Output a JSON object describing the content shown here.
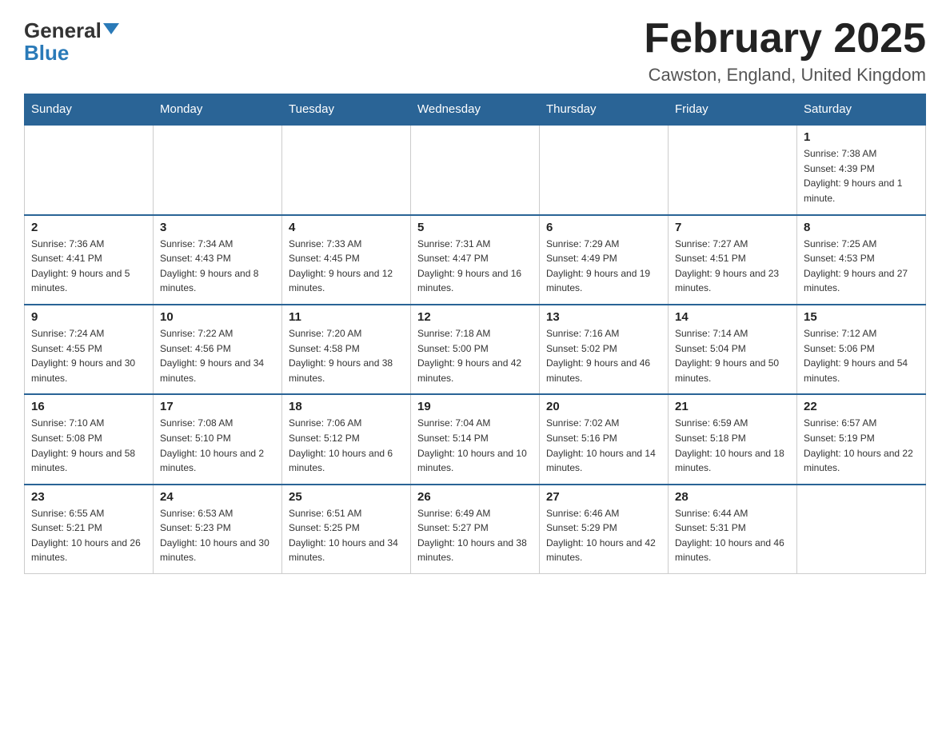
{
  "header": {
    "logo_general": "General",
    "logo_blue": "Blue",
    "title": "February 2025",
    "subtitle": "Cawston, England, United Kingdom"
  },
  "days_of_week": [
    "Sunday",
    "Monday",
    "Tuesday",
    "Wednesday",
    "Thursday",
    "Friday",
    "Saturday"
  ],
  "weeks": [
    [
      {
        "day": "",
        "sunrise": "",
        "sunset": "",
        "daylight": "",
        "empty": true
      },
      {
        "day": "",
        "sunrise": "",
        "sunset": "",
        "daylight": "",
        "empty": true
      },
      {
        "day": "",
        "sunrise": "",
        "sunset": "",
        "daylight": "",
        "empty": true
      },
      {
        "day": "",
        "sunrise": "",
        "sunset": "",
        "daylight": "",
        "empty": true
      },
      {
        "day": "",
        "sunrise": "",
        "sunset": "",
        "daylight": "",
        "empty": true
      },
      {
        "day": "",
        "sunrise": "",
        "sunset": "",
        "daylight": "",
        "empty": true
      },
      {
        "day": "1",
        "sunrise": "Sunrise: 7:38 AM",
        "sunset": "Sunset: 4:39 PM",
        "daylight": "Daylight: 9 hours and 1 minute.",
        "empty": false
      }
    ],
    [
      {
        "day": "2",
        "sunrise": "Sunrise: 7:36 AM",
        "sunset": "Sunset: 4:41 PM",
        "daylight": "Daylight: 9 hours and 5 minutes.",
        "empty": false
      },
      {
        "day": "3",
        "sunrise": "Sunrise: 7:34 AM",
        "sunset": "Sunset: 4:43 PM",
        "daylight": "Daylight: 9 hours and 8 minutes.",
        "empty": false
      },
      {
        "day": "4",
        "sunrise": "Sunrise: 7:33 AM",
        "sunset": "Sunset: 4:45 PM",
        "daylight": "Daylight: 9 hours and 12 minutes.",
        "empty": false
      },
      {
        "day": "5",
        "sunrise": "Sunrise: 7:31 AM",
        "sunset": "Sunset: 4:47 PM",
        "daylight": "Daylight: 9 hours and 16 minutes.",
        "empty": false
      },
      {
        "day": "6",
        "sunrise": "Sunrise: 7:29 AM",
        "sunset": "Sunset: 4:49 PM",
        "daylight": "Daylight: 9 hours and 19 minutes.",
        "empty": false
      },
      {
        "day": "7",
        "sunrise": "Sunrise: 7:27 AM",
        "sunset": "Sunset: 4:51 PM",
        "daylight": "Daylight: 9 hours and 23 minutes.",
        "empty": false
      },
      {
        "day": "8",
        "sunrise": "Sunrise: 7:25 AM",
        "sunset": "Sunset: 4:53 PM",
        "daylight": "Daylight: 9 hours and 27 minutes.",
        "empty": false
      }
    ],
    [
      {
        "day": "9",
        "sunrise": "Sunrise: 7:24 AM",
        "sunset": "Sunset: 4:55 PM",
        "daylight": "Daylight: 9 hours and 30 minutes.",
        "empty": false
      },
      {
        "day": "10",
        "sunrise": "Sunrise: 7:22 AM",
        "sunset": "Sunset: 4:56 PM",
        "daylight": "Daylight: 9 hours and 34 minutes.",
        "empty": false
      },
      {
        "day": "11",
        "sunrise": "Sunrise: 7:20 AM",
        "sunset": "Sunset: 4:58 PM",
        "daylight": "Daylight: 9 hours and 38 minutes.",
        "empty": false
      },
      {
        "day": "12",
        "sunrise": "Sunrise: 7:18 AM",
        "sunset": "Sunset: 5:00 PM",
        "daylight": "Daylight: 9 hours and 42 minutes.",
        "empty": false
      },
      {
        "day": "13",
        "sunrise": "Sunrise: 7:16 AM",
        "sunset": "Sunset: 5:02 PM",
        "daylight": "Daylight: 9 hours and 46 minutes.",
        "empty": false
      },
      {
        "day": "14",
        "sunrise": "Sunrise: 7:14 AM",
        "sunset": "Sunset: 5:04 PM",
        "daylight": "Daylight: 9 hours and 50 minutes.",
        "empty": false
      },
      {
        "day": "15",
        "sunrise": "Sunrise: 7:12 AM",
        "sunset": "Sunset: 5:06 PM",
        "daylight": "Daylight: 9 hours and 54 minutes.",
        "empty": false
      }
    ],
    [
      {
        "day": "16",
        "sunrise": "Sunrise: 7:10 AM",
        "sunset": "Sunset: 5:08 PM",
        "daylight": "Daylight: 9 hours and 58 minutes.",
        "empty": false
      },
      {
        "day": "17",
        "sunrise": "Sunrise: 7:08 AM",
        "sunset": "Sunset: 5:10 PM",
        "daylight": "Daylight: 10 hours and 2 minutes.",
        "empty": false
      },
      {
        "day": "18",
        "sunrise": "Sunrise: 7:06 AM",
        "sunset": "Sunset: 5:12 PM",
        "daylight": "Daylight: 10 hours and 6 minutes.",
        "empty": false
      },
      {
        "day": "19",
        "sunrise": "Sunrise: 7:04 AM",
        "sunset": "Sunset: 5:14 PM",
        "daylight": "Daylight: 10 hours and 10 minutes.",
        "empty": false
      },
      {
        "day": "20",
        "sunrise": "Sunrise: 7:02 AM",
        "sunset": "Sunset: 5:16 PM",
        "daylight": "Daylight: 10 hours and 14 minutes.",
        "empty": false
      },
      {
        "day": "21",
        "sunrise": "Sunrise: 6:59 AM",
        "sunset": "Sunset: 5:18 PM",
        "daylight": "Daylight: 10 hours and 18 minutes.",
        "empty": false
      },
      {
        "day": "22",
        "sunrise": "Sunrise: 6:57 AM",
        "sunset": "Sunset: 5:19 PM",
        "daylight": "Daylight: 10 hours and 22 minutes.",
        "empty": false
      }
    ],
    [
      {
        "day": "23",
        "sunrise": "Sunrise: 6:55 AM",
        "sunset": "Sunset: 5:21 PM",
        "daylight": "Daylight: 10 hours and 26 minutes.",
        "empty": false
      },
      {
        "day": "24",
        "sunrise": "Sunrise: 6:53 AM",
        "sunset": "Sunset: 5:23 PM",
        "daylight": "Daylight: 10 hours and 30 minutes.",
        "empty": false
      },
      {
        "day": "25",
        "sunrise": "Sunrise: 6:51 AM",
        "sunset": "Sunset: 5:25 PM",
        "daylight": "Daylight: 10 hours and 34 minutes.",
        "empty": false
      },
      {
        "day": "26",
        "sunrise": "Sunrise: 6:49 AM",
        "sunset": "Sunset: 5:27 PM",
        "daylight": "Daylight: 10 hours and 38 minutes.",
        "empty": false
      },
      {
        "day": "27",
        "sunrise": "Sunrise: 6:46 AM",
        "sunset": "Sunset: 5:29 PM",
        "daylight": "Daylight: 10 hours and 42 minutes.",
        "empty": false
      },
      {
        "day": "28",
        "sunrise": "Sunrise: 6:44 AM",
        "sunset": "Sunset: 5:31 PM",
        "daylight": "Daylight: 10 hours and 46 minutes.",
        "empty": false
      },
      {
        "day": "",
        "sunrise": "",
        "sunset": "",
        "daylight": "",
        "empty": true
      }
    ]
  ]
}
